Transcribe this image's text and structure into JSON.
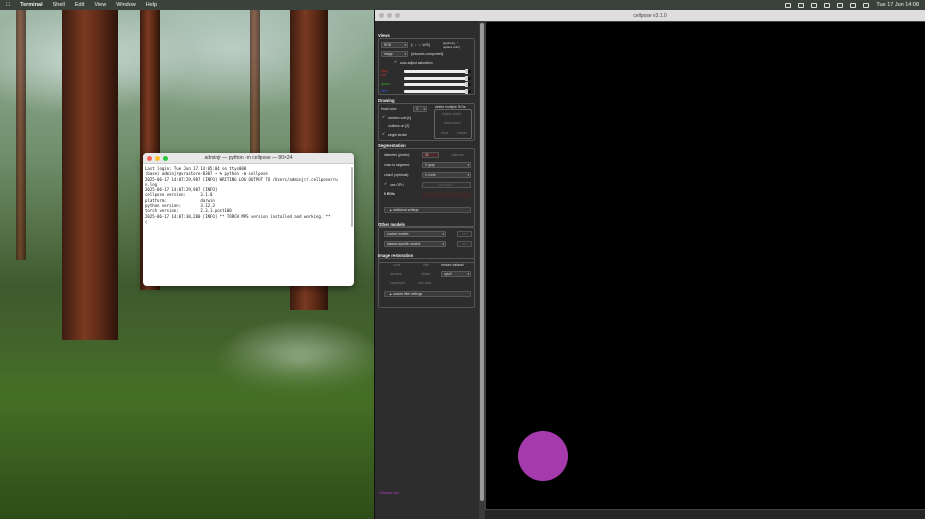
{
  "menubar": {
    "app_name": "Terminal",
    "menus": [
      "Shell",
      "Edit",
      "View",
      "Window",
      "Help"
    ],
    "datetime": "Tue 17 Jun  14:08"
  },
  "terminal": {
    "title": "adminjr — python -m cellpose — 80×24",
    "lines": [
      "Last login: Tue Jun 17 14:05:04 on ttys000",
      "(base) adminjr@vrastore-0307 ~ % python -m cellpose",
      "2025-06-17 14:07:29,987 [INFO] WRITING LOG OUTPUT TO /Users/adminjr/.cellpose/ru",
      "n.log",
      "2025-06-17 14:07:29,987 [INFO]",
      "cellpose version:      3.1.0",
      "platform:              darwin",
      "python version:        3.12.3",
      "torch version:         2.3.1.post100",
      "2025-06-17 14:07:30,280 [INFO] ** TORCH MPS version installed and working. **",
      "▯"
    ]
  },
  "cellpose": {
    "title": "cellpose v3.1.0",
    "views": {
      "title": "Views",
      "view_combo": "RGB",
      "view_hint": "[↑ ↓ ↑ ↓ W/S]",
      "shortcut_hint": "[pgdn/up] - '',\nreplace color]",
      "color_combo": "image",
      "color_hint": "[chooses component]",
      "auto_adjust_label": "auto-adjust saturation",
      "channels": [
        {
          "name": "gray",
          "color": "#d03030",
          "level": 0.95
        },
        {
          "name": "red",
          "color": "#d03030",
          "level": 0.95
        },
        {
          "name": "green",
          "color": "#30b030",
          "level": 0.95
        },
        {
          "name": "blue",
          "color": "#3060e0",
          "level": 0.95
        }
      ]
    },
    "drawing": {
      "title": "Drawing",
      "brush_label": "brush size",
      "brush_value": "3",
      "checks": [
        "random cols [k]",
        "outlines on [Z]",
        "single stroke"
      ],
      "delete_box_title": "delete multiple ROIs",
      "delete_buttons": [
        "region select",
        "click select",
        "done",
        "cancel"
      ]
    },
    "segmentation": {
      "title": "Segmentation",
      "diameter_label": "diameter (pixels):",
      "diameter_value": "30",
      "calibrate_label": "calibrate",
      "chan_label": "chan to segment:",
      "chan_value": "0: gray",
      "chan2_label": "chan2 (optional):",
      "chan2_value": "0: none",
      "gpu_label": "use GPU",
      "run_label": "run cyto3",
      "rois_label": "0 ROIs",
      "additional_label": "additional settings"
    },
    "other_models": {
      "title": "Other models",
      "custom_combo": "custom models",
      "custom_run": "run",
      "dataset_combo": "dataset-specific models",
      "dataset_run": "run"
    },
    "restoration": {
      "title": "Image restoration",
      "buttons_row1": [
        "none",
        "filter",
        "restore dataset"
      ],
      "buttons_row2": [
        "denoise",
        "deblur",
        "cyto3"
      ],
      "buttons_row3": [
        "upsample",
        "one-click"
      ],
      "custom_filter_label": "custom filter settings"
    },
    "footer_link": "Cellpose info",
    "mask_color": "#a53aad"
  }
}
